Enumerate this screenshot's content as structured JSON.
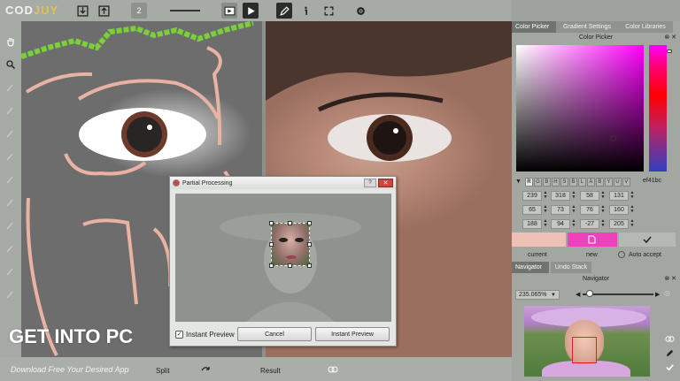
{
  "app": {
    "logo_main": "COD",
    "logo_accent": "JUY"
  },
  "toolbar": {
    "brush_size": "2"
  },
  "dialog": {
    "title": "Partial Processing",
    "help": "?",
    "close": "✕",
    "instant_preview_label": "Instant Preview",
    "cancel_label": "Cancel",
    "instant_preview_button": "Instant Preview"
  },
  "bottom": {
    "split_label": "Split",
    "result_label": "Result"
  },
  "watermark": {
    "main": "GET INTO PC",
    "sub": "Download Free Your Desired App"
  },
  "right_panel": {
    "tabs": [
      {
        "label": "Color Picker",
        "active": true
      },
      {
        "label": "Gradient Settings",
        "active": false
      },
      {
        "label": "Color Libraries",
        "active": false
      }
    ],
    "color_picker_title": "Color Picker",
    "modes": [
      "R",
      "G",
      "B",
      "H",
      "S",
      "B",
      "L",
      "A",
      "B",
      "Y",
      "U",
      "V"
    ],
    "hex": "ef41bc",
    "values": [
      [
        "239",
        "318",
        "58",
        "131"
      ],
      [
        "65",
        "73",
        "76",
        "160"
      ],
      [
        "188",
        "94",
        "-27",
        "205"
      ]
    ],
    "current_label": "current",
    "new_label": "new",
    "auto_accept_label": "Auto accept",
    "bottom_tabs": [
      {
        "label": "Navigator",
        "active": true
      },
      {
        "label": "Undo Stack",
        "active": false
      }
    ],
    "navigator_title": "Navigator",
    "zoom": "235.065%",
    "colors": {
      "current": "#efc1b5",
      "new": "#ef41bc"
    }
  }
}
